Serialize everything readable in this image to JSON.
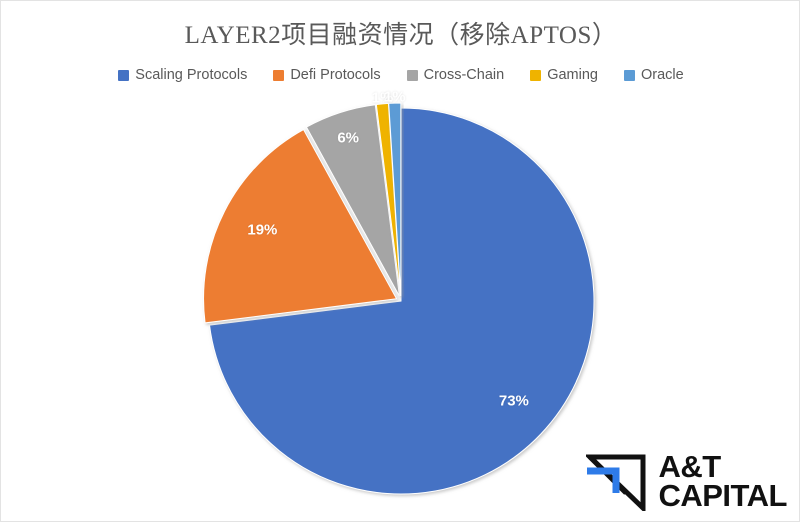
{
  "chart_data": {
    "type": "pie",
    "title": "LAYER2项目融资情况（移除APTOS）",
    "categories": [
      "Scaling Protocols",
      "Defi Protocols",
      "Cross-Chain",
      "Gaming",
      "Oracle"
    ],
    "values": [
      73,
      19,
      6,
      1,
      1
    ],
    "value_labels": [
      "73%",
      "19%",
      "6%",
      "1%",
      "1%"
    ],
    "colors": [
      "#4472C4",
      "#ED7D31",
      "#A5A5A5",
      "#EFB300",
      "#5B9BD5"
    ],
    "legend_position": "top",
    "grid": false,
    "start_angle_deg": 0,
    "direction": "clockwise",
    "units": "percent",
    "xlabel": "",
    "ylabel": ""
  },
  "legend": {
    "items": [
      {
        "label": "Scaling Protocols",
        "color": "#4472C4"
      },
      {
        "label": "Defi Protocols",
        "color": "#ED7D31"
      },
      {
        "label": "Cross-Chain",
        "color": "#A5A5A5"
      },
      {
        "label": "Gaming",
        "color": "#EFB300"
      },
      {
        "label": "Oracle",
        "color": "#5B9BD5"
      }
    ]
  },
  "brand": {
    "line1": "A&T",
    "line2": "CAPITAL",
    "mark_color": "#111111",
    "accent_color": "#2E7BE8"
  }
}
